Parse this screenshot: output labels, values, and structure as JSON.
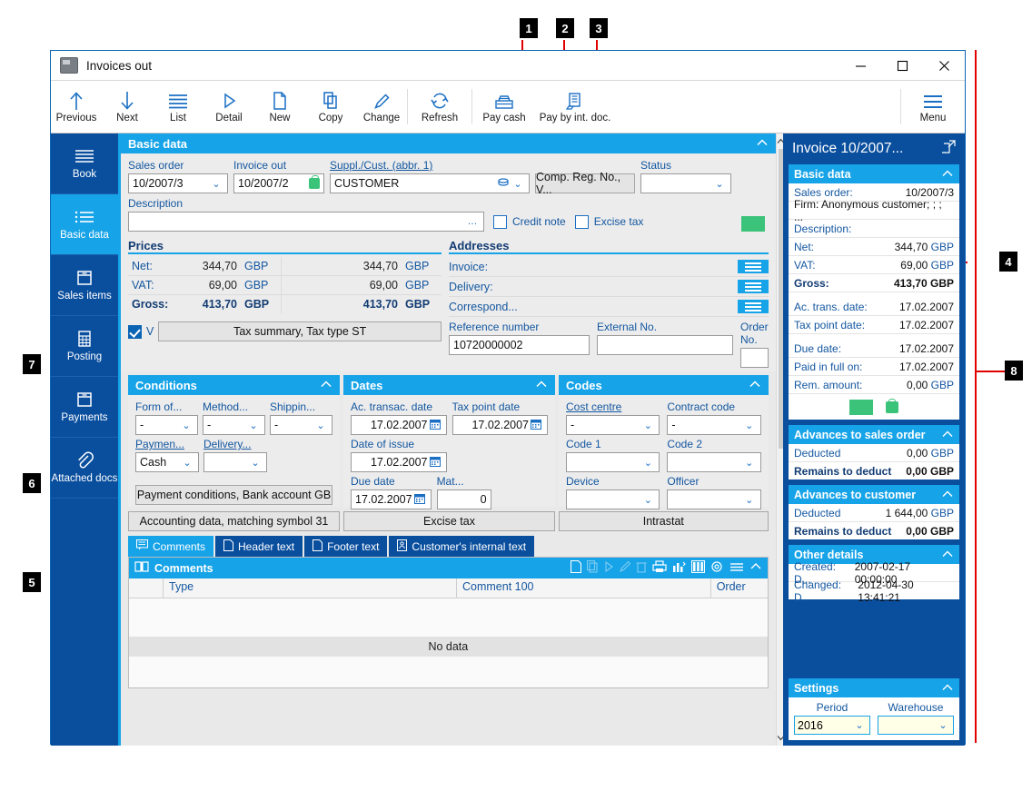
{
  "window": {
    "title": "Invoices out",
    "controls": {
      "minimize": "minimize-button",
      "maximize": "maximize-button",
      "close": "close-button"
    }
  },
  "toolbar": {
    "items": [
      {
        "label": "Previous",
        "icon": "arrow-up-icon"
      },
      {
        "label": "Next",
        "icon": "arrow-down-icon"
      },
      {
        "label": "List",
        "icon": "list-icon"
      },
      {
        "label": "Detail",
        "icon": "play-triangle-icon"
      },
      {
        "label": "New",
        "icon": "document-icon"
      },
      {
        "label": "Copy",
        "icon": "copy-icon"
      },
      {
        "label": "Change",
        "icon": "pencil-icon"
      },
      {
        "label": "Refresh",
        "icon": "refresh-icon"
      },
      {
        "label": "Pay cash",
        "icon": "cash-register-icon"
      },
      {
        "label": "Pay by int. doc.",
        "icon": "internal-document-icon"
      },
      {
        "label": "Menu",
        "icon": "hamburger-icon"
      }
    ]
  },
  "sidebar": {
    "items": [
      {
        "label": "Book",
        "icon": "book-lines-icon",
        "active": false
      },
      {
        "label": "Basic data",
        "icon": "basic-data-icon",
        "active": true
      },
      {
        "label": "Sales items",
        "icon": "box-icon",
        "active": false
      },
      {
        "label": "Posting",
        "icon": "calculator-icon",
        "active": false
      },
      {
        "label": "Payments",
        "icon": "box-icon",
        "active": false
      },
      {
        "label": "Attached docs",
        "icon": "paperclip-icon",
        "active": false
      }
    ]
  },
  "basic_data": {
    "header": "Basic data",
    "sales_order": {
      "label": "Sales order",
      "value": "10/2007/3"
    },
    "invoice_out": {
      "label": "Invoice out",
      "value": "10/2007/2"
    },
    "supplier": {
      "label": "Suppl./Cust. (abbr. 1)",
      "value": "CUSTOMER"
    },
    "comp_reg": {
      "label": "Comp. Reg. No., V..."
    },
    "status": {
      "label": "Status",
      "value": ""
    },
    "description": {
      "label": "Description",
      "value": "",
      "ellipsis": "…"
    },
    "credit_note": {
      "label": "Credit note",
      "checked": false
    },
    "excise_tax": {
      "label": "Excise tax",
      "checked": false
    }
  },
  "prices": {
    "header": "Prices",
    "rows": [
      {
        "key": "Net:",
        "amount": "344,70",
        "currency": "GBP",
        "amount2": "344,70",
        "currency2": "GBP",
        "bold": false
      },
      {
        "key": "VAT:",
        "amount": "69,00",
        "currency": "GBP",
        "amount2": "69,00",
        "currency2": "GBP",
        "bold": false
      },
      {
        "key": "Gross:",
        "amount": "413,70",
        "currency": "GBP",
        "amount2": "413,70",
        "currency2": "GBP",
        "bold": true
      }
    ],
    "tax_checkbox": {
      "checked": true,
      "letter": "V"
    },
    "tax_button": "Tax summary, Tax type ST"
  },
  "addresses": {
    "header": "Addresses",
    "rows": [
      "Invoice:",
      "Delivery:",
      "Correspond..."
    ],
    "reference_number": {
      "label": "Reference number",
      "value": "10720000002"
    },
    "external_no": {
      "label": "External No.",
      "value": ""
    },
    "order_no": {
      "label": "Order No.",
      "value": ""
    }
  },
  "conditions": {
    "header": "Conditions",
    "fields": [
      {
        "label": "Form of...",
        "value": "-"
      },
      {
        "label": "Method...",
        "value": "-"
      },
      {
        "label": "Shippin...",
        "value": "-"
      },
      {
        "label": "Paymen...",
        "value": "Cash",
        "underline": true
      },
      {
        "label": "Delivery...",
        "value": "",
        "underline": true
      }
    ],
    "button": "Payment conditions, Bank account GB"
  },
  "dates": {
    "header": "Dates",
    "fields": [
      {
        "label": "Ac. transac. date",
        "value": "17.02.2007",
        "calendar": true
      },
      {
        "label": "Tax point date",
        "value": "17.02.2007",
        "calendar": true
      },
      {
        "label": "Date of issue",
        "value": "17.02.2007",
        "calendar": true
      },
      {
        "label": "Due date",
        "value": "17.02.2007",
        "calendar": true
      },
      {
        "label": "Mat...",
        "value": "0",
        "calendar": false
      }
    ]
  },
  "codes": {
    "header": "Codes",
    "fields": [
      {
        "label": "Cost centre",
        "value": "-",
        "underline": true
      },
      {
        "label": "Contract code",
        "value": "-"
      },
      {
        "label": "Code 1",
        "value": ""
      },
      {
        "label": "Code 2",
        "value": ""
      },
      {
        "label": "Device",
        "value": ""
      },
      {
        "label": "Officer",
        "value": ""
      }
    ]
  },
  "action_buttons": [
    "Accounting data, matching symbol 31",
    "Excise tax",
    "Intrastat"
  ],
  "text_tabs": [
    {
      "label": "Comments",
      "icon": "comment-icon",
      "active": true
    },
    {
      "label": "Header text",
      "icon": "document-icon",
      "active": false
    },
    {
      "label": "Footer text",
      "icon": "document-icon",
      "active": false
    },
    {
      "label": "Customer's internal text",
      "icon": "person-doc-icon",
      "active": false
    }
  ],
  "comments_grid": {
    "title": "Comments",
    "columns": [
      "Type",
      "Comment 100",
      "Order"
    ],
    "empty_text": "No data",
    "tools": [
      "new-icon",
      "copy-icon",
      "detail-icon",
      "edit-icon",
      "delete-icon",
      "print-icon",
      "chart-icon",
      "columns-icon",
      "settings-icon",
      "menu-icon",
      "collapse-icon"
    ]
  },
  "right_panel": {
    "title": "Invoice 10/2007...",
    "open_icon": "open-external-icon",
    "basic_data": {
      "header": "Basic data",
      "rows": [
        {
          "key": "Sales order:",
          "value": "10/2007/3"
        },
        {
          "key": "Firm: Anonymous customer; ; ; ...",
          "value": ""
        },
        {
          "key": "Description:",
          "value": ""
        },
        {
          "key": "Net:",
          "value": "344,70",
          "currency": "GBP"
        },
        {
          "key": "VAT:",
          "value": "69,00",
          "currency": "GBP"
        },
        {
          "key": "Gross:",
          "value": "413,70",
          "currency": "GBP",
          "bold": true
        },
        {
          "key": "Ac. trans. date:",
          "value": "17.02.2007"
        },
        {
          "key": "Tax point date:",
          "value": "17.02.2007"
        },
        {
          "key": "Due date:",
          "value": "17.02.2007"
        },
        {
          "key": "Paid in full on:",
          "value": "17.02.2007"
        },
        {
          "key": "Rem. amount:",
          "value": "0,00",
          "currency": "GBP"
        }
      ]
    },
    "advances_sales_order": {
      "header": "Advances to sales order",
      "rows": [
        {
          "key": "Deducted",
          "value": "0,00",
          "currency": "GBP",
          "bold": false
        },
        {
          "key": "Remains to deduct",
          "value": "0,00",
          "currency": "GBP",
          "bold": true
        }
      ]
    },
    "advances_customer": {
      "header": "Advances to customer",
      "rows": [
        {
          "key": "Deducted",
          "value": "1 644,00",
          "currency": "GBP",
          "bold": false
        },
        {
          "key": "Remains to deduct",
          "value": "0,00",
          "currency": "GBP",
          "bold": true
        }
      ]
    },
    "other_details": {
      "header": "Other details",
      "rows": [
        {
          "key": "Created:  D...",
          "value": "2007-02-17 00:00:00"
        },
        {
          "key": "Changed: D...",
          "value": "2012-04-30 13:41:21"
        }
      ]
    },
    "settings": {
      "header": "Settings",
      "period": {
        "label": "Period",
        "value": "2016"
      },
      "warehouse": {
        "label": "Warehouse",
        "value": ""
      }
    }
  },
  "callouts": [
    {
      "n": "1"
    },
    {
      "n": "2"
    },
    {
      "n": "3"
    },
    {
      "n": "4"
    },
    {
      "n": "5"
    },
    {
      "n": "6"
    },
    {
      "n": "7"
    },
    {
      "n": "8"
    }
  ],
  "colors": {
    "accent_blue": "#17a3e8",
    "dark_blue": "#0a4f9e",
    "label_blue": "#1457a0",
    "green": "#3cc37a",
    "callout_red": "#e00000"
  }
}
